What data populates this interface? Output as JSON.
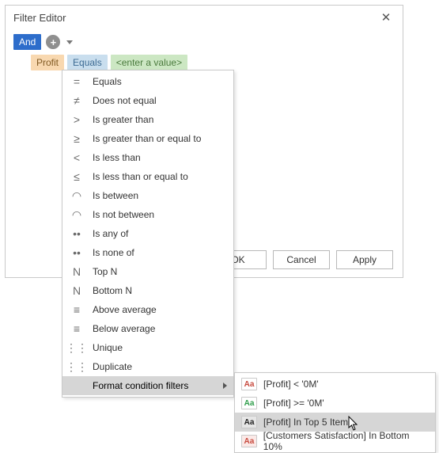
{
  "dialog": {
    "title": "Filter Editor"
  },
  "root_group": "And",
  "condition": {
    "field": "Profit",
    "operator": "Equals",
    "value_placeholder": "<enter a value>"
  },
  "operators_menu": {
    "items": [
      {
        "label": "Equals",
        "icon": "="
      },
      {
        "label": "Does not equal",
        "icon": "≠"
      },
      {
        "label": "Is greater than",
        "icon": ">"
      },
      {
        "label": "Is greater than or equal to",
        "icon": "≥"
      },
      {
        "label": "Is less than",
        "icon": "<"
      },
      {
        "label": "Is less than or equal to",
        "icon": "≤"
      },
      {
        "label": "Is between",
        "icon": "◠"
      },
      {
        "label": "Is not between",
        "icon": "◠"
      },
      {
        "label": "Is any of",
        "icon": "••"
      },
      {
        "label": "Is none of",
        "icon": "••"
      },
      {
        "label": "Top N",
        "icon": "N"
      },
      {
        "label": "Bottom N",
        "icon": "N"
      },
      {
        "label": "Above average",
        "icon": "≡"
      },
      {
        "label": "Below average",
        "icon": "≡"
      },
      {
        "label": "Unique",
        "icon": "⋮⋮"
      },
      {
        "label": "Duplicate",
        "icon": "⋮⋮"
      },
      {
        "label": "Format condition filters",
        "icon": ""
      }
    ],
    "highlighted_index": 16
  },
  "format_submenu": {
    "items": [
      {
        "label": "[Profit] < '0M'",
        "aa_class": "aa-red"
      },
      {
        "label": "[Profit] >= '0M'",
        "aa_class": "aa-green"
      },
      {
        "label": "[Profit] In Top 5 Items",
        "aa_class": "aa-black"
      },
      {
        "label": "[Customers Satisfaction] In Bottom 10%",
        "aa_class": "aa-redbg"
      }
    ],
    "highlighted_index": 2
  },
  "buttons": {
    "ok": "OK",
    "cancel": "Cancel",
    "apply": "Apply"
  }
}
